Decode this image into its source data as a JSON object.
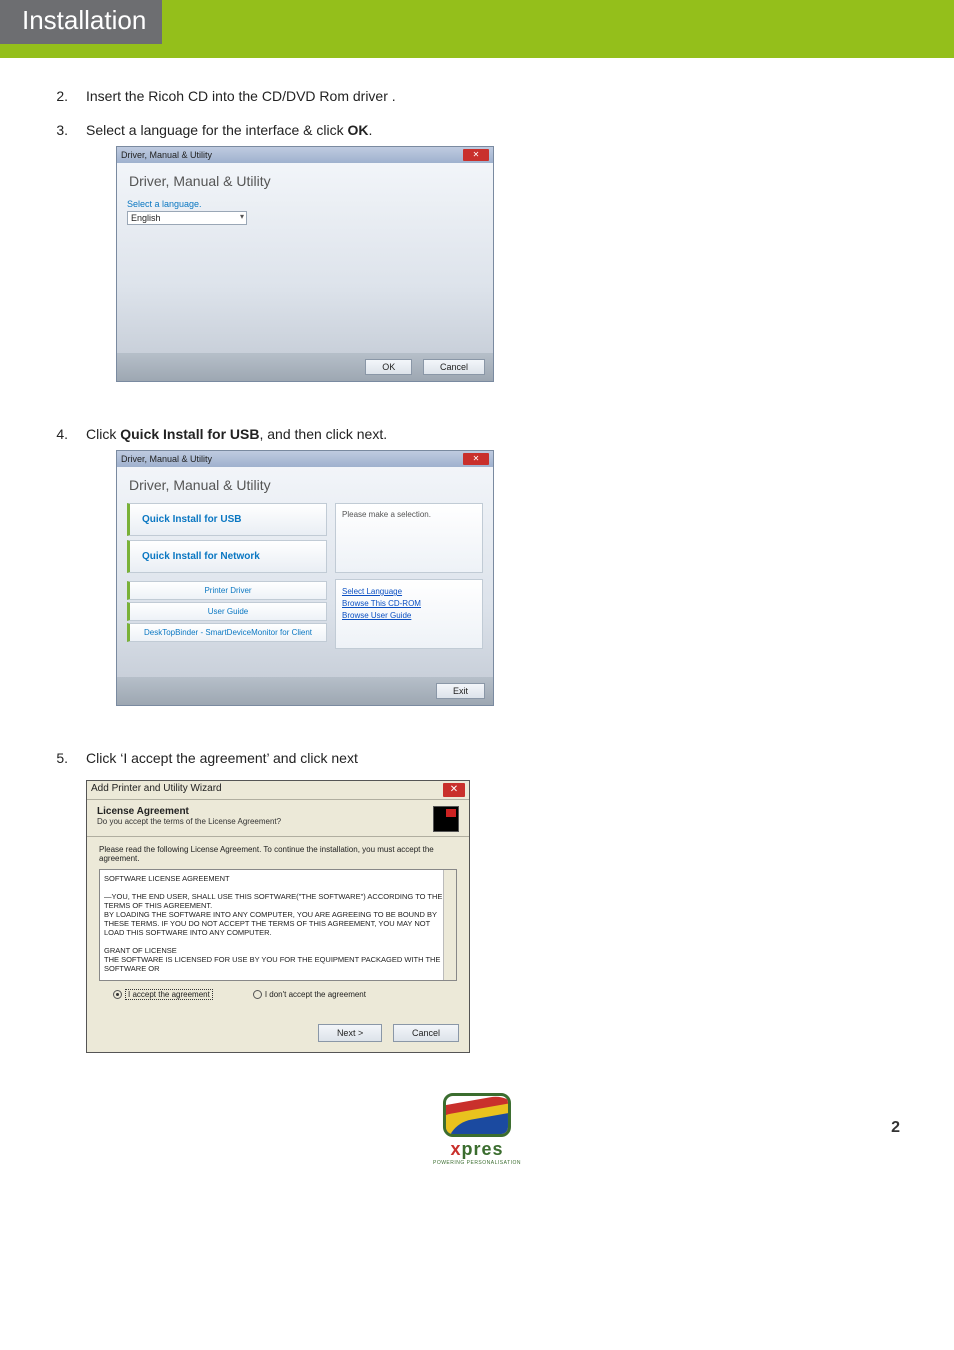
{
  "banner": {
    "title": "Installation"
  },
  "steps": [
    {
      "num": "2.",
      "text": "Insert the Ricoh CD into the CD/DVD Rom driver ."
    },
    {
      "num": "3.",
      "text_plain": "Select a language for the interface & click ",
      "bold": "OK",
      "tail": "."
    },
    {
      "num": "4.",
      "text_plain": "Click ",
      "bold": "Quick Install for USB",
      "tail": ", and then click next."
    },
    {
      "num": "5.",
      "text_plain": "Click ‘I accept the agreement’ and click next"
    }
  ],
  "win1": {
    "title": "Driver, Manual & Utility",
    "heading": "Driver, Manual & Utility",
    "lang_label": "Select a language.",
    "lang_value": "English",
    "ok": "OK",
    "cancel": "Cancel"
  },
  "win2": {
    "title": "Driver, Manual & Utility",
    "heading": "Driver, Manual & Utility",
    "big1": "Quick Install for USB",
    "big2": "Quick Install for Network",
    "small": [
      "Printer Driver",
      "User Guide",
      "DeskTopBinder - SmartDeviceMonitor for Client"
    ],
    "right_hint": "Please make a selection.",
    "links": [
      "Select Language",
      "Browse This CD-ROM",
      "Browse User Guide"
    ],
    "exit": "Exit"
  },
  "win3": {
    "title": "Add Printer and Utility Wizard",
    "head1": "License Agreement",
    "head2": "Do you accept the terms of the License Agreement?",
    "intro": "Please read the following License Agreement. To continue the installation, you must accept the agreement.",
    "eula": "SOFTWARE LICENSE AGREEMENT\n\n—YOU, THE END USER, SHALL USE THIS SOFTWARE(\"THE SOFTWARE\") ACCORDING TO THE TERMS OF THIS AGREEMENT.\nBY LOADING THE SOFTWARE INTO ANY COMPUTER, YOU ARE AGREEING TO BE BOUND BY THESE TERMS. IF YOU DO NOT ACCEPT THE TERMS OF THIS AGREEMENT, YOU MAY NOT LOAD THIS SOFTWARE INTO ANY COMPUTER.\n\nGrant of License\nThe Software is licensed for use by you for the equipment packaged with the Software or",
    "accept": "I accept the agreement",
    "decline": "I don't accept the agreement",
    "next": "Next >",
    "cancel": "Cancel"
  },
  "brand": {
    "name_x": "x",
    "name_rest": "pres",
    "sub": "POWERING PERSONALISATION",
    "page": "2"
  }
}
